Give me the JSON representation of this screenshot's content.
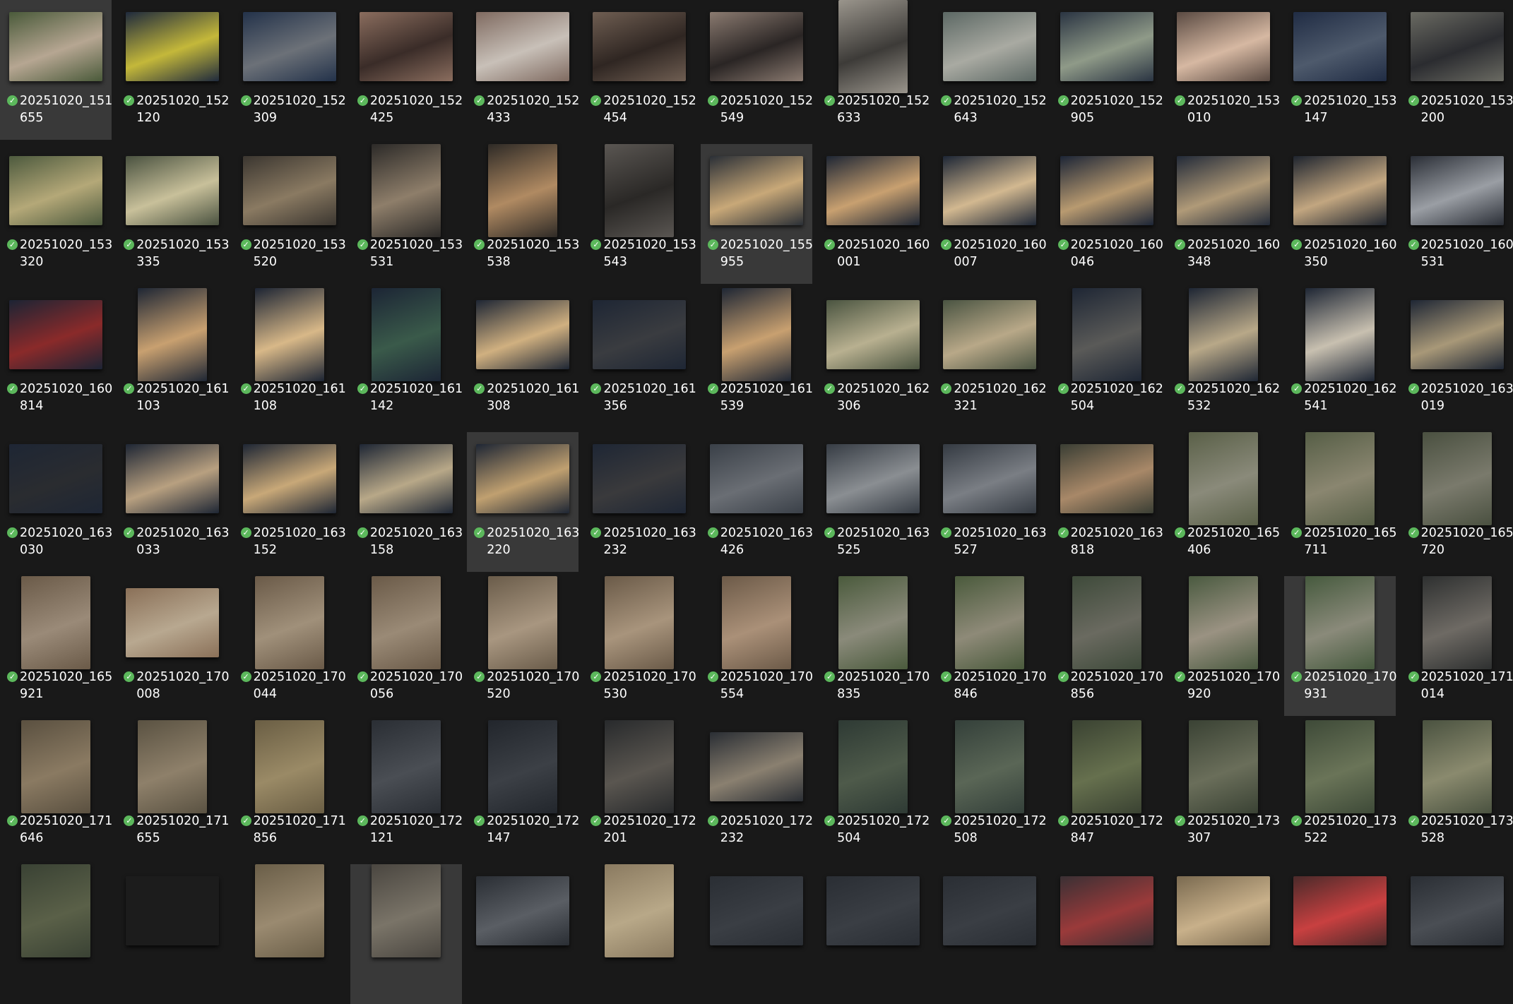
{
  "view": {
    "selected_indices": [
      0,
      19,
      43,
      63,
      81
    ]
  },
  "files": [
    {
      "l1": "20251020_151",
      "l2": "655",
      "o": "h",
      "c": [
        "#4a5a3a",
        "#b6a692"
      ]
    },
    {
      "l1": "20251020_152",
      "l2": "120",
      "o": "h",
      "c": [
        "#1f2a3d",
        "#c4b83a"
      ]
    },
    {
      "l1": "20251020_152",
      "l2": "309",
      "o": "h",
      "c": [
        "#23324a",
        "#6c7178"
      ]
    },
    {
      "l1": "20251020_152",
      "l2": "425",
      "o": "h",
      "c": [
        "#8a6d5e",
        "#3a2c28"
      ]
    },
    {
      "l1": "20251020_152",
      "l2": "433",
      "o": "h",
      "c": [
        "#7f6a60",
        "#c8c0b8"
      ]
    },
    {
      "l1": "20251020_152",
      "l2": "454",
      "o": "h",
      "c": [
        "#6f5e52",
        "#2f2622"
      ]
    },
    {
      "l1": "20251020_152",
      "l2": "549",
      "o": "h",
      "c": [
        "#8a7a70",
        "#2a2524"
      ]
    },
    {
      "l1": "20251020_152",
      "l2": "633",
      "o": "v",
      "c": [
        "#9a958c",
        "#3d3b38"
      ]
    },
    {
      "l1": "20251020_152",
      "l2": "643",
      "o": "h",
      "c": [
        "#5c6864",
        "#a9aaa2"
      ]
    },
    {
      "l1": "20251020_152",
      "l2": "905",
      "o": "h",
      "c": [
        "#2a3442",
        "#8f9a88"
      ]
    },
    {
      "l1": "20251020_153",
      "l2": "010",
      "o": "h",
      "c": [
        "#5a4a42",
        "#d6b8a2"
      ]
    },
    {
      "l1": "20251020_153",
      "l2": "147",
      "o": "h",
      "c": [
        "#202c44",
        "#4e5a6c"
      ]
    },
    {
      "l1": "20251020_153",
      "l2": "200",
      "o": "h",
      "c": [
        "#6a6a62",
        "#2b2c30"
      ]
    },
    {
      "l1": "20251020_153",
      "l2": "320",
      "o": "h",
      "c": [
        "#4d5a3e",
        "#b4a878"
      ]
    },
    {
      "l1": "20251020_153",
      "l2": "335",
      "o": "h",
      "c": [
        "#4a5240",
        "#c8c09a"
      ]
    },
    {
      "l1": "20251020_153",
      "l2": "520",
      "o": "h",
      "c": [
        "#3b3630",
        "#8a7a62"
      ]
    },
    {
      "l1": "20251020_153",
      "l2": "531",
      "o": "v",
      "c": [
        "#2c2a28",
        "#8e7e6a"
      ]
    },
    {
      "l1": "20251020_153",
      "l2": "538",
      "o": "v",
      "c": [
        "#2e2a26",
        "#b08a62"
      ]
    },
    {
      "l1": "20251020_153",
      "l2": "543",
      "o": "v",
      "c": [
        "#5a5652",
        "#2a2826"
      ]
    },
    {
      "l1": "20251020_155",
      "l2": "955",
      "o": "h",
      "c": [
        "#2a2f36",
        "#c8a878"
      ]
    },
    {
      "l1": "20251020_160",
      "l2": "001",
      "o": "h",
      "c": [
        "#1e2634",
        "#c8a070"
      ]
    },
    {
      "l1": "20251020_160",
      "l2": "007",
      "o": "h",
      "c": [
        "#1d2635",
        "#d2b890"
      ]
    },
    {
      "l1": "20251020_160",
      "l2": "046",
      "o": "h",
      "c": [
        "#1c2536",
        "#b89a70"
      ]
    },
    {
      "l1": "20251020_160",
      "l2": "348",
      "o": "h",
      "c": [
        "#222a38",
        "#b09a78"
      ]
    },
    {
      "l1": "20251020_160",
      "l2": "350",
      "o": "h",
      "c": [
        "#1e242e",
        "#c2a680"
      ]
    },
    {
      "l1": "20251020_160",
      "l2": "531",
      "o": "h",
      "c": [
        "#2a2e36",
        "#9a9ea4"
      ]
    },
    {
      "l1": "20251020_160",
      "l2": "814",
      "o": "h",
      "c": [
        "#1c2434",
        "#8a2a2a"
      ]
    },
    {
      "l1": "20251020_161",
      "l2": "103",
      "o": "v",
      "c": [
        "#1e2634",
        "#c8a070"
      ]
    },
    {
      "l1": "20251020_161",
      "l2": "108",
      "o": "v",
      "c": [
        "#1c2433",
        "#d8b888"
      ]
    },
    {
      "l1": "20251020_161",
      "l2": "142",
      "o": "v",
      "c": [
        "#1c2535",
        "#3a5a4a"
      ]
    },
    {
      "l1": "20251020_161",
      "l2": "308",
      "o": "h",
      "c": [
        "#1e2634",
        "#d0b080"
      ]
    },
    {
      "l1": "20251020_161",
      "l2": "356",
      "o": "h",
      "c": [
        "#1e2634",
        "#3a3c40"
      ]
    },
    {
      "l1": "20251020_161",
      "l2": "539",
      "o": "v",
      "c": [
        "#1e2634",
        "#c8a070"
      ]
    },
    {
      "l1": "20251020_162",
      "l2": "306",
      "o": "h",
      "c": [
        "#4a5440",
        "#b8b090"
      ]
    },
    {
      "l1": "20251020_162",
      "l2": "321",
      "o": "h",
      "c": [
        "#4a5442",
        "#b8a888"
      ]
    },
    {
      "l1": "20251020_162",
      "l2": "504",
      "o": "v",
      "c": [
        "#1e2634",
        "#5a5a58"
      ]
    },
    {
      "l1": "20251020_162",
      "l2": "532",
      "o": "v",
      "c": [
        "#1e2634",
        "#b8a888"
      ]
    },
    {
      "l1": "20251020_162",
      "l2": "541",
      "o": "v",
      "c": [
        "#1e2634",
        "#c8c0b0"
      ]
    },
    {
      "l1": "20251020_163",
      "l2": "019",
      "o": "h",
      "c": [
        "#1e2634",
        "#a89878"
      ]
    },
    {
      "l1": "20251020_163",
      "l2": "030",
      "o": "h",
      "c": [
        "#1e2634",
        "#2a2c30"
      ]
    },
    {
      "l1": "20251020_163",
      "l2": "033",
      "o": "h",
      "c": [
        "#1e2634",
        "#b8a080"
      ]
    },
    {
      "l1": "20251020_163",
      "l2": "152",
      "o": "h",
      "c": [
        "#1e2634",
        "#c8a878"
      ]
    },
    {
      "l1": "20251020_163",
      "l2": "158",
      "o": "h",
      "c": [
        "#1e2634",
        "#b8a888"
      ]
    },
    {
      "l1": "20251020_163",
      "l2": "220",
      "o": "h",
      "c": [
        "#1e2634",
        "#c0a070"
      ]
    },
    {
      "l1": "20251020_163",
      "l2": "232",
      "o": "h",
      "c": [
        "#1e2634",
        "#3a3a3c"
      ]
    },
    {
      "l1": "20251020_163",
      "l2": "426",
      "o": "h",
      "c": [
        "#3a4048",
        "#6a6e74"
      ]
    },
    {
      "l1": "20251020_163",
      "l2": "525",
      "o": "h",
      "c": [
        "#363c44",
        "#8a8e92"
      ]
    },
    {
      "l1": "20251020_163",
      "l2": "527",
      "o": "h",
      "c": [
        "#343a42",
        "#7a7e84"
      ]
    },
    {
      "l1": "20251020_163",
      "l2": "818",
      "o": "h",
      "c": [
        "#3a3e34",
        "#a88868"
      ]
    },
    {
      "l1": "20251020_165",
      "l2": "406",
      "o": "v",
      "c": [
        "#5a6048",
        "#8a8a7a"
      ]
    },
    {
      "l1": "20251020_165",
      "l2": "711",
      "o": "v",
      "c": [
        "#565e46",
        "#8a8670"
      ]
    },
    {
      "l1": "20251020_165",
      "l2": "720",
      "o": "v",
      "c": [
        "#4a5040",
        "#7a7a6c"
      ]
    },
    {
      "l1": "20251020_165",
      "l2": "921",
      "o": "v",
      "c": [
        "#6a5a48",
        "#9a8a78"
      ]
    },
    {
      "l1": "20251020_170",
      "l2": "008",
      "o": "h",
      "c": [
        "#8a7058",
        "#b8a890"
      ]
    },
    {
      "l1": "20251020_170",
      "l2": "044",
      "o": "v",
      "c": [
        "#6a5a48",
        "#a0907a"
      ]
    },
    {
      "l1": "20251020_170",
      "l2": "056",
      "o": "v",
      "c": [
        "#6a5a48",
        "#9a8a76"
      ]
    },
    {
      "l1": "20251020_170",
      "l2": "520",
      "o": "v",
      "c": [
        "#6a5c4a",
        "#a89680"
      ]
    },
    {
      "l1": "20251020_170",
      "l2": "530",
      "o": "v",
      "c": [
        "#6a5a48",
        "#a8947c"
      ]
    },
    {
      "l1": "20251020_170",
      "l2": "554",
      "o": "v",
      "c": [
        "#6c5a48",
        "#aa9078"
      ]
    },
    {
      "l1": "20251020_170",
      "l2": "835",
      "o": "v",
      "c": [
        "#4a5a3c",
        "#8a8a7a"
      ]
    },
    {
      "l1": "20251020_170",
      "l2": "846",
      "o": "v",
      "c": [
        "#4a5a3c",
        "#8e8a78"
      ]
    },
    {
      "l1": "20251020_170",
      "l2": "856",
      "o": "v",
      "c": [
        "#3e4a3a",
        "#6a6a60"
      ]
    },
    {
      "l1": "20251020_170",
      "l2": "920",
      "o": "v",
      "c": [
        "#4a5a40",
        "#9a9282"
      ]
    },
    {
      "l1": "20251020_170",
      "l2": "931",
      "o": "v",
      "c": [
        "#465a3e",
        "#8a8a7a"
      ]
    },
    {
      "l1": "20251020_171",
      "l2": "014",
      "o": "v",
      "c": [
        "#2e3030",
        "#6e6a64"
      ]
    },
    {
      "l1": "20251020_171",
      "l2": "646",
      "o": "v",
      "c": [
        "#5a5040",
        "#8a7a62"
      ]
    },
    {
      "l1": "20251020_171",
      "l2": "655",
      "o": "v",
      "c": [
        "#5a5242",
        "#8e806a"
      ]
    },
    {
      "l1": "20251020_171",
      "l2": "856",
      "o": "v",
      "c": [
        "#6a5e44",
        "#9a8a66"
      ]
    },
    {
      "l1": "20251020_172",
      "l2": "121",
      "o": "v",
      "c": [
        "#2a2e34",
        "#4a4e54"
      ]
    },
    {
      "l1": "20251020_172",
      "l2": "147",
      "o": "v",
      "c": [
        "#22262c",
        "#3c4046"
      ]
    },
    {
      "l1": "20251020_172",
      "l2": "201",
      "o": "v",
      "c": [
        "#282a2c",
        "#5a5650"
      ]
    },
    {
      "l1": "20251020_172",
      "l2": "232",
      "o": "h",
      "c": [
        "#2a2e34",
        "#8a8070"
      ]
    },
    {
      "l1": "20251020_172",
      "l2": "504",
      "o": "v",
      "c": [
        "#2e3a34",
        "#4e5a4a"
      ]
    },
    {
      "l1": "20251020_172",
      "l2": "508",
      "o": "v",
      "c": [
        "#34403a",
        "#5a6656"
      ]
    },
    {
      "l1": "20251020_172",
      "l2": "847",
      "o": "v",
      "c": [
        "#3a4232",
        "#66704e"
      ]
    },
    {
      "l1": "20251020_173",
      "l2": "307",
      "o": "v",
      "c": [
        "#3a4234",
        "#6a6e5a"
      ]
    },
    {
      "l1": "20251020_173",
      "l2": "522",
      "o": "v",
      "c": [
        "#3e4a38",
        "#6a7458"
      ]
    },
    {
      "l1": "20251020_173",
      "l2": "528",
      "o": "v",
      "c": [
        "#4a5240",
        "#8a8a6e"
      ]
    },
    {
      "l1": "",
      "l2": "",
      "o": "v",
      "c": [
        "#3a4234",
        "#5a6048"
      ]
    },
    {
      "l1": "",
      "l2": "",
      "o": "h",
      "c": [
        "#1c1c1c",
        "#1c1c1c"
      ]
    },
    {
      "l1": "",
      "l2": "",
      "o": "v",
      "c": [
        "#6a5e48",
        "#9a8a70"
      ]
    },
    {
      "l1": "",
      "l2": "",
      "o": "v",
      "c": [
        "#4a4640",
        "#7a7468"
      ]
    },
    {
      "l1": "",
      "l2": "",
      "o": "h",
      "c": [
        "#2a2e34",
        "#5a5e64"
      ]
    },
    {
      "l1": "",
      "l2": "",
      "o": "v",
      "c": [
        "#8a7a60",
        "#b8a888"
      ]
    },
    {
      "l1": "",
      "l2": "",
      "o": "h",
      "c": [
        "#2a2e34",
        "#3a3e44"
      ]
    },
    {
      "l1": "",
      "l2": "",
      "o": "h",
      "c": [
        "#2a2e34",
        "#3a3e44"
      ]
    },
    {
      "l1": "",
      "l2": "",
      "o": "h",
      "c": [
        "#2a2e34",
        "#3a3e44"
      ]
    },
    {
      "l1": "",
      "l2": "",
      "o": "h",
      "c": [
        "#3a3034",
        "#9a3a3a"
      ]
    },
    {
      "l1": "",
      "l2": "",
      "o": "h",
      "c": [
        "#7a6a50",
        "#c8b08a"
      ]
    },
    {
      "l1": "",
      "l2": "",
      "o": "h",
      "c": [
        "#4a2a2a",
        "#c84040"
      ]
    },
    {
      "l1": "",
      "l2": "",
      "o": "h",
      "c": [
        "#2a2e34",
        "#4a4e54"
      ]
    }
  ]
}
